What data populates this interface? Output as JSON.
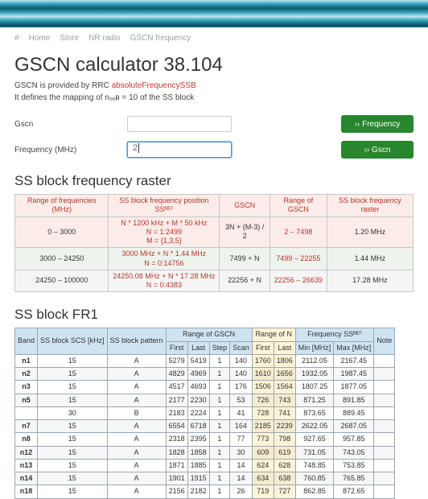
{
  "breadcrumb": {
    "home": "#",
    "items": [
      "Home",
      "Store",
      "NR radio",
      "GSCN frequency"
    ]
  },
  "title": "GSCN calculator 38.104",
  "desc_line1_pre": "GSCN is provided by RRC ",
  "desc_line1_link": "absoluteFrequencySSB",
  "desc_line2": "It defines the mapping of nₒₒʙ = 10 of the SS block",
  "form": {
    "gscn_label": "Gscn",
    "freq_label": "Frequency (MHz)",
    "gscn_value": "",
    "freq_value": "2",
    "btn_freq": "Frequency",
    "btn_gscn": "Gscn"
  },
  "raster_heading": "SS block frequency raster",
  "raster": {
    "headers": [
      "Range of frequencies (MHz)",
      "SS block frequency position SSᴿᴱꟳ",
      "GSCN",
      "Range of GSCN",
      "SS block frequency raster"
    ],
    "rows": [
      {
        "range": "0 – 3000",
        "pos": "N * 1200 kHz + M * 50 kHz\nN = 1:2499\nM = {1,3,5}",
        "gscn": "3N + (M-3) / 2",
        "rgscn": "2 – 7498",
        "step": "1.20 MHz"
      },
      {
        "range": "3000 – 24250",
        "pos": "3000 MHz + N * 1.44 MHz\nN = 0:14756",
        "gscn": "7499 + N",
        "rgscn": "7499 – 22255",
        "step": "1.44 MHz"
      },
      {
        "range": "24250 – 100000",
        "pos": "24250.08 MHz + N * 17.28 MHz\nN = 0:4383",
        "gscn": "22256 + N",
        "rgscn": "22256 – 26639",
        "step": "17.28 MHz"
      }
    ]
  },
  "fr1_heading": "SS block FR1",
  "fr1": {
    "group_headers": [
      "Band",
      "SS block SCS [kHz]",
      "SS block pattern",
      "Range of GSCN",
      "Range of N",
      "Frequency SSᴿᴱꟳ",
      "Note"
    ],
    "sub_headers": [
      "First",
      "Last",
      "Step",
      "Scan",
      "First",
      "Last",
      "Min [MHz]",
      "Max [MHz]"
    ],
    "rows": [
      {
        "band": "n1",
        "scs": "15",
        "pat": "A",
        "g": [
          "5279",
          "5419",
          "1",
          "140"
        ],
        "n": [
          "1760",
          "1806"
        ],
        "f": [
          "2112.05",
          "2167.45"
        ],
        "note": ""
      },
      {
        "band": "n2",
        "scs": "15",
        "pat": "A",
        "g": [
          "4829",
          "4969",
          "1",
          "140"
        ],
        "n": [
          "1610",
          "1656"
        ],
        "f": [
          "1932.05",
          "1987.45"
        ],
        "note": ""
      },
      {
        "band": "n3",
        "scs": "15",
        "pat": "A",
        "g": [
          "4517",
          "4693",
          "1",
          "176"
        ],
        "n": [
          "1506",
          "1564"
        ],
        "f": [
          "1807.25",
          "1877.05"
        ],
        "note": ""
      },
      {
        "band": "n5",
        "scs": "15",
        "pat": "A",
        "g": [
          "2177",
          "2230",
          "1",
          "53"
        ],
        "n": [
          "726",
          "743"
        ],
        "f": [
          "871.25",
          "891.85"
        ],
        "note": ""
      },
      {
        "band": " ",
        "scs": "30",
        "pat": "B",
        "g": [
          "2183",
          "2224",
          "1",
          "41"
        ],
        "n": [
          "728",
          "741"
        ],
        "f": [
          "873.65",
          "889.45"
        ],
        "note": ""
      },
      {
        "band": "n7",
        "scs": "15",
        "pat": "A",
        "g": [
          "6554",
          "6718",
          "1",
          "164"
        ],
        "n": [
          "2185",
          "2239"
        ],
        "f": [
          "2622.05",
          "2687.05"
        ],
        "note": ""
      },
      {
        "band": "n8",
        "scs": "15",
        "pat": "A",
        "g": [
          "2318",
          "2395",
          "1",
          "77"
        ],
        "n": [
          "773",
          "798"
        ],
        "f": [
          "927.65",
          "957.85"
        ],
        "note": ""
      },
      {
        "band": "n12",
        "scs": "15",
        "pat": "A",
        "g": [
          "1828",
          "1858",
          "1",
          "30"
        ],
        "n": [
          "609",
          "619"
        ],
        "f": [
          "731.05",
          "743.05"
        ],
        "note": ""
      },
      {
        "band": "n13",
        "scs": "15",
        "pat": "A",
        "g": [
          "1871",
          "1885",
          "1",
          "14"
        ],
        "n": [
          "624",
          "628"
        ],
        "f": [
          "748.85",
          "753.85"
        ],
        "note": ""
      },
      {
        "band": "n14",
        "scs": "15",
        "pat": "A",
        "g": [
          "1901",
          "1915",
          "1",
          "14"
        ],
        "n": [
          "634",
          "638"
        ],
        "f": [
          "760.85",
          "765.85"
        ],
        "note": ""
      },
      {
        "band": "n18",
        "scs": "15",
        "pat": "A",
        "g": [
          "2156",
          "2182",
          "1",
          "26"
        ],
        "n": [
          "719",
          "727"
        ],
        "f": [
          "862.85",
          "872.65"
        ],
        "note": ""
      }
    ]
  }
}
